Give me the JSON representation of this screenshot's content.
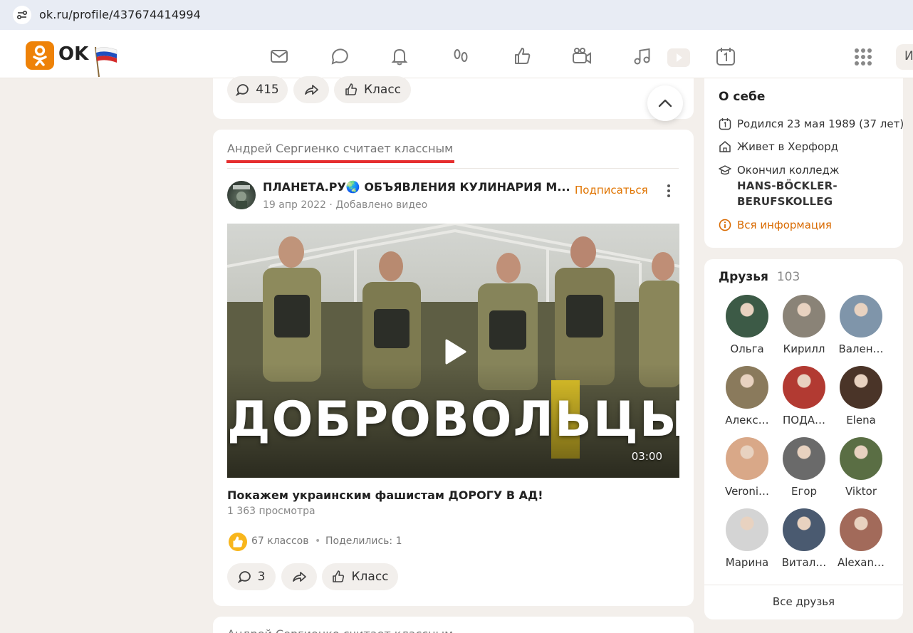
{
  "browser": {
    "url": "ok.ru/profile/437674414994"
  },
  "header": {
    "logo_text": "OK",
    "search_stub": "И",
    "nav": [
      "messages-icon",
      "discussions-icon",
      "notifications-icon",
      "guests-icon",
      "ratings-icon",
      "video-icon",
      "music-icon",
      "events-icon",
      "apps-grid-icon"
    ]
  },
  "prev_post": {
    "comments": "415",
    "like_label": "Класс"
  },
  "post": {
    "caption": "Андрей Сергиенко считает классным",
    "group_name": "ПЛАНЕТА.РУ🌏 ОБЪЯВЛЕНИЯ КУЛИНАРИЯ М...",
    "subscribe": "Подписаться",
    "date": "19 апр 2022",
    "meta_action": "Добавлено видео",
    "video_overlay_text": "ДОБРОВОЛЬЦЫ",
    "duration": "03:00",
    "title": "Покажем украинским фашистам ДОРОГУ В АД!",
    "views": "1 363 просмотра",
    "likes": "67 классов",
    "shared": "Поделились: 1",
    "comments": "3",
    "like_label": "Класс"
  },
  "next_post": {
    "caption": "Андрей Сергиенко считает классным"
  },
  "about": {
    "title": "О себе",
    "born": "Родился 23 мая 1989 (37 лет)",
    "lives": "Живет в Херфорд",
    "education_prefix": "Окончил колледж",
    "education_name": "HANS-BÖCKLER-BERUFSKOLLEG",
    "all_info": "Вся информация"
  },
  "friends": {
    "title": "Друзья",
    "count": "103",
    "all_label": "Все друзья",
    "items": [
      {
        "name": "Ольга",
        "color": "#3c5a46"
      },
      {
        "name": "Кирилл",
        "color": "#8a8377"
      },
      {
        "name": "Вален…",
        "color": "#7f95aa"
      },
      {
        "name": "Алекс…",
        "color": "#8a7a5c"
      },
      {
        "name": "ПОДА…",
        "color": "#b23a32"
      },
      {
        "name": "Elena",
        "color": "#4a3428"
      },
      {
        "name": "Veroni…",
        "color": "#d9a888"
      },
      {
        "name": "Егор",
        "color": "#6a6a6a"
      },
      {
        "name": "Viktor",
        "color": "#5a6e44"
      },
      {
        "name": "Марина",
        "color": "#d4d4d4"
      },
      {
        "name": "Витал…",
        "color": "#4a5a70"
      },
      {
        "name": "Alexan…",
        "color": "#a26a5a"
      }
    ]
  }
}
